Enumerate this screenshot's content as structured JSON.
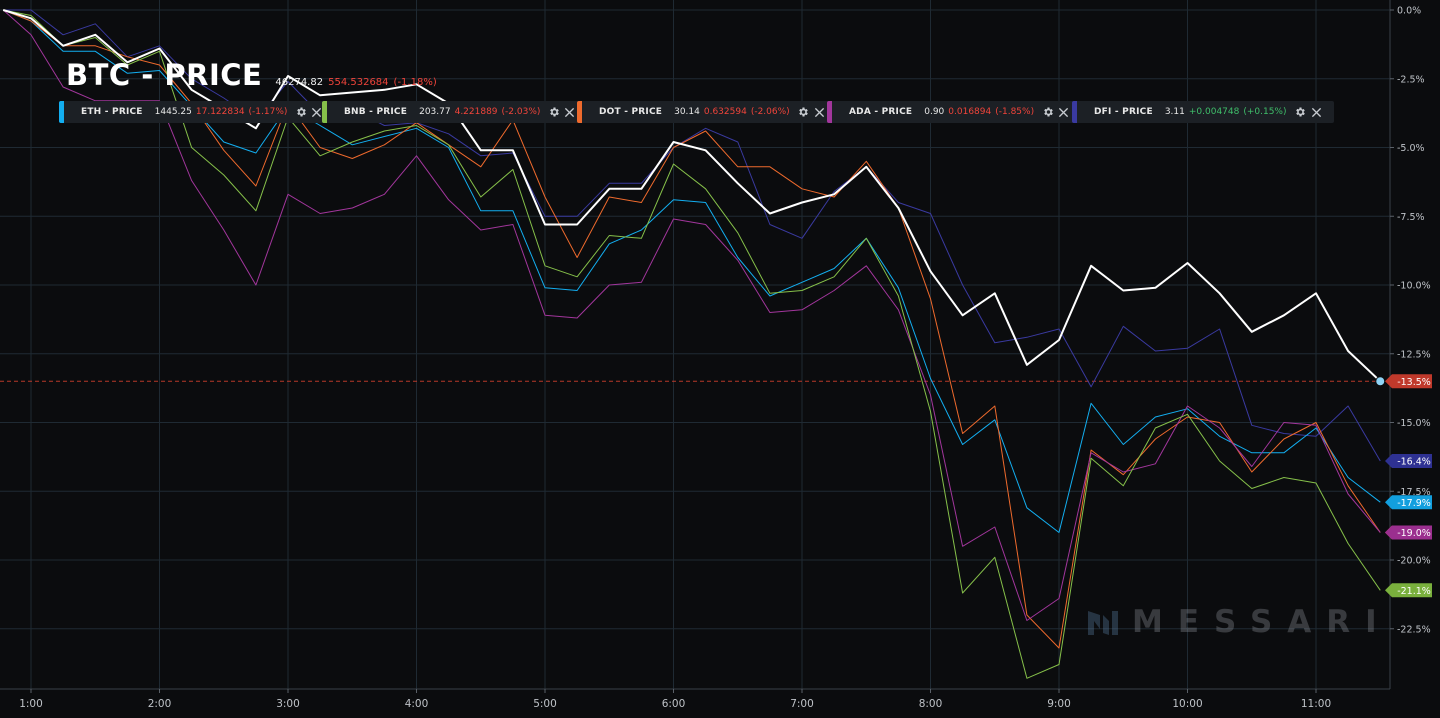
{
  "colors": {
    "background": "#0b0c0e",
    "grid": "#1f2a33",
    "axis_text": "#bfc3c8",
    "btc": "#ffffff",
    "eth": "#13aef0",
    "bnb": "#86c04a",
    "dot": "#ee6a2d",
    "ada": "#a2369c",
    "dfi": "#3a3aa0",
    "crosshair": "#d6402e"
  },
  "main_legend": {
    "title": "BTC - PRICE",
    "value": "46274.82",
    "change": "554.532684",
    "percent": "(-1.18%)"
  },
  "legend_items": [
    {
      "name": "ETH - PRICE",
      "value": "1445.25",
      "change": "17.122834",
      "percent": "(-1.17%)",
      "color": "#13aef0",
      "trend": "neg"
    },
    {
      "name": "BNB - PRICE",
      "value": "203.77",
      "change": "4.221889",
      "percent": "(-2.03%)",
      "color": "#86c04a",
      "trend": "neg"
    },
    {
      "name": "DOT - PRICE",
      "value": "30.14",
      "change": "0.632594",
      "percent": "(-2.06%)",
      "color": "#ee6a2d",
      "trend": "neg"
    },
    {
      "name": "ADA - PRICE",
      "value": "0.90",
      "change": "0.016894",
      "percent": "(-1.85%)",
      "color": "#a2369c",
      "trend": "neg"
    },
    {
      "name": "DFI - PRICE",
      "value": "3.11",
      "change": "+0.004748",
      "percent": "(+0.15%)",
      "color": "#3a3aa0",
      "trend": "pos"
    }
  ],
  "legend_icons": {
    "settings": "gear-icon",
    "close": "close-icon"
  },
  "watermark": {
    "text": "MESSARI",
    "logo": "messari-logo-icon"
  },
  "chart_data": {
    "type": "line",
    "y_unit": "percent",
    "y_range": [
      -24.5,
      0.3
    ],
    "y_ticks": [
      0,
      -2.5,
      -5,
      -7.5,
      -10,
      -12.5,
      -15,
      -17.5,
      -20,
      -22.5
    ],
    "y_tick_labels": [
      "0.0%",
      "-2.5%",
      "-5.0%",
      "-7.5%",
      "-10.0%",
      "-12.5%",
      "-15.0%",
      "-17.5%",
      "-20.0%",
      "-22.5%"
    ],
    "x_range": [
      0.7833,
      11.6167
    ],
    "x_ticks": [
      1,
      2,
      3,
      4,
      5,
      6,
      7,
      8,
      9,
      10,
      11
    ],
    "x_tick_labels": [
      "1:00",
      "2:00",
      "3:00",
      "4:00",
      "5:00",
      "6:00",
      "7:00",
      "8:00",
      "9:00",
      "10:00",
      "11:00"
    ],
    "grid": true,
    "crosshair_y": -13.5,
    "x": [
      0.7833,
      1.0,
      1.25,
      1.5,
      1.75,
      2.0,
      2.25,
      2.5,
      2.75,
      3.0,
      3.25,
      3.5,
      3.75,
      4.0,
      4.25,
      4.5,
      4.75,
      5.0,
      5.25,
      5.5,
      5.75,
      6.0,
      6.25,
      6.5,
      6.75,
      7.0,
      7.25,
      7.5,
      7.75,
      8.0,
      8.25,
      8.5,
      8.75,
      9.0,
      9.25,
      9.5,
      9.75,
      10.0,
      10.25,
      10.5,
      10.75,
      11.0,
      11.25,
      11.5
    ],
    "series": [
      {
        "key": "dfi",
        "end_label": "-16.4%",
        "values": [
          0.0,
          0.0,
          -0.9,
          -0.5,
          -1.7,
          -1.3,
          -2.5,
          -3.2,
          -4.0,
          -2.6,
          -3.8,
          -3.6,
          -4.2,
          -4.1,
          -4.5,
          -5.3,
          -5.2,
          -7.5,
          -7.5,
          -6.3,
          -6.3,
          -5.0,
          -4.3,
          -4.8,
          -7.8,
          -8.3,
          -6.6,
          -5.7,
          -7.0,
          -7.4,
          -10.0,
          -12.1,
          -11.9,
          -11.6,
          -13.7,
          -11.5,
          -12.4,
          -12.3,
          -11.6,
          -15.1,
          -15.4,
          -15.5,
          -14.4,
          -16.4
        ]
      },
      {
        "key": "eth",
        "end_label": "-17.9%",
        "values": [
          0.0,
          -0.4,
          -1.5,
          -1.5,
          -2.3,
          -2.2,
          -3.5,
          -4.8,
          -5.2,
          -3.5,
          -4.2,
          -4.9,
          -4.6,
          -4.3,
          -5.0,
          -7.3,
          -7.3,
          -10.1,
          -10.2,
          -8.5,
          -8.0,
          -6.9,
          -7.0,
          -9.0,
          -10.4,
          -9.9,
          -9.4,
          -8.3,
          -10.1,
          -13.4,
          -15.8,
          -14.9,
          -18.1,
          -19.0,
          -14.3,
          -15.8,
          -14.8,
          -14.5,
          -15.5,
          -16.1,
          -16.1,
          -15.2,
          -17.0,
          -17.9
        ]
      },
      {
        "key": "dot",
        "end_label": "-19.0%",
        "values": [
          0.0,
          -0.4,
          -1.3,
          -1.3,
          -1.7,
          -2.0,
          -3.4,
          -5.1,
          -6.4,
          -3.4,
          -5.0,
          -5.4,
          -4.9,
          -4.1,
          -4.9,
          -5.7,
          -4.0,
          -6.8,
          -9.0,
          -6.8,
          -7.0,
          -5.0,
          -4.4,
          -5.7,
          -5.7,
          -6.5,
          -6.8,
          -5.5,
          -7.2,
          -10.5,
          -15.4,
          -14.4,
          -22.0,
          -23.2,
          -16.0,
          -16.9,
          -15.6,
          -14.8,
          -15.0,
          -16.8,
          -15.6,
          -15.0,
          -17.3,
          -19.0
        ]
      },
      {
        "key": "ada",
        "end_label": "-19.0%",
        "values": [
          0.0,
          -0.9,
          -2.8,
          -3.3,
          -3.3,
          -3.3,
          -6.2,
          -8.0,
          -10.0,
          -6.7,
          -7.4,
          -7.2,
          -6.7,
          -5.3,
          -6.9,
          -8.0,
          -7.8,
          -11.1,
          -11.2,
          -10.0,
          -9.9,
          -7.6,
          -7.8,
          -9.1,
          -11.0,
          -10.9,
          -10.2,
          -9.3,
          -10.9,
          -14.0,
          -19.5,
          -18.8,
          -22.2,
          -21.4,
          -16.1,
          -16.8,
          -16.5,
          -14.4,
          -15.2,
          -16.6,
          -15.0,
          -15.1,
          -17.6,
          -19.0
        ]
      },
      {
        "key": "bnb",
        "end_label": "-21.1%",
        "values": [
          0.0,
          -0.2,
          -1.3,
          -1.0,
          -2.0,
          -1.5,
          -5.0,
          -6.0,
          -7.3,
          -3.9,
          -5.3,
          -4.8,
          -4.4,
          -4.2,
          -4.9,
          -6.8,
          -5.8,
          -9.3,
          -9.7,
          -8.2,
          -8.3,
          -5.6,
          -6.5,
          -8.1,
          -10.3,
          -10.2,
          -9.7,
          -8.3,
          -10.4,
          -14.6,
          -21.2,
          -19.9,
          -24.3,
          -23.8,
          -16.3,
          -17.3,
          -15.2,
          -14.7,
          -16.4,
          -17.4,
          -17.0,
          -17.2,
          -19.4,
          -21.1
        ]
      },
      {
        "key": "btc",
        "end_label": "-13.5%",
        "values": [
          0.0,
          -0.3,
          -1.3,
          -0.9,
          -1.9,
          -1.4,
          -2.9,
          -3.6,
          -4.3,
          -2.4,
          -3.1,
          -3.0,
          -2.9,
          -2.7,
          -3.4,
          -5.1,
          -5.1,
          -7.8,
          -7.8,
          -6.5,
          -6.5,
          -4.8,
          -5.1,
          -6.3,
          -7.4,
          -7.0,
          -6.7,
          -5.7,
          -7.2,
          -9.5,
          -11.1,
          -10.3,
          -12.9,
          -12.0,
          -9.3,
          -10.2,
          -10.1,
          -9.2,
          -10.3,
          -11.7,
          -11.1,
          -10.3,
          -12.4,
          -13.5
        ]
      }
    ]
  }
}
